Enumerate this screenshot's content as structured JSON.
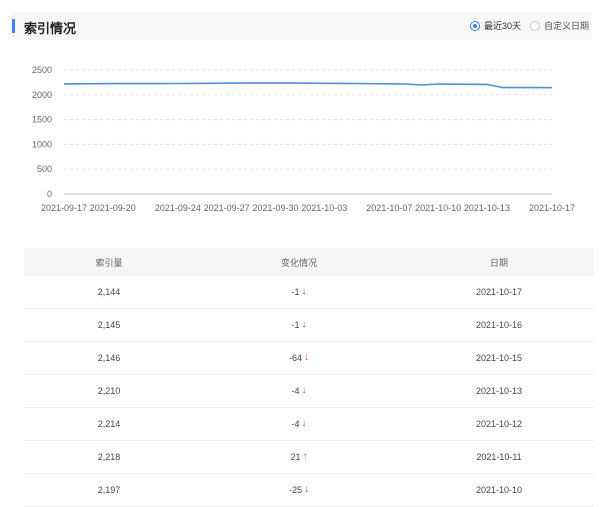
{
  "section": {
    "title": "索引情况",
    "range_options": [
      {
        "label": "最近30天",
        "selected": true
      },
      {
        "label": "自定义日期",
        "selected": false
      }
    ]
  },
  "chart_data": {
    "type": "line",
    "x": [
      "2021-09-17",
      "2021-09-18",
      "2021-09-19",
      "2021-09-20",
      "2021-09-21",
      "2021-09-22",
      "2021-09-23",
      "2021-09-24",
      "2021-09-25",
      "2021-09-26",
      "2021-09-27",
      "2021-09-28",
      "2021-09-29",
      "2021-09-30",
      "2021-10-01",
      "2021-10-02",
      "2021-10-03",
      "2021-10-04",
      "2021-10-05",
      "2021-10-06",
      "2021-10-07",
      "2021-10-08",
      "2021-10-09",
      "2021-10-10",
      "2021-10-11",
      "2021-10-12",
      "2021-10-13",
      "2021-10-14",
      "2021-10-15",
      "2021-10-16",
      "2021-10-17"
    ],
    "series": [
      {
        "values": [
          2220,
          2222,
          2224,
          2225,
          2225,
          2226,
          2226,
          2228,
          2230,
          2232,
          2234,
          2236,
          2236,
          2236,
          2236,
          2234,
          2232,
          2230,
          2228,
          2224,
          2222,
          2218,
          2197,
          2218,
          2214,
          2212,
          2210,
          2146,
          2145,
          2146,
          2144
        ],
        "color": "#4a90e2"
      }
    ],
    "x_tick_labels": [
      "2021-09-17",
      "2021-09-20",
      "2021-09-24",
      "2021-09-27",
      "2021-09-30",
      "2021-10-03",
      "2021-10-07",
      "2021-10-10",
      "2021-10-13",
      "2021-10-17"
    ],
    "y_ticks": [
      0,
      500,
      1000,
      1500,
      2000,
      2500
    ],
    "ylim": [
      0,
      2500
    ],
    "grid": true
  },
  "table": {
    "headers": [
      "索引量",
      "变化情况",
      "日期"
    ],
    "rows": [
      {
        "count": "2,144",
        "change": "-1",
        "dir": "down",
        "date": "2021-10-17"
      },
      {
        "count": "2,145",
        "change": "-1",
        "dir": "down",
        "date": "2021-10-16"
      },
      {
        "count": "2,146",
        "change": "-64",
        "dir": "down",
        "date": "2021-10-15"
      },
      {
        "count": "2,210",
        "change": "-4",
        "dir": "down",
        "date": "2021-10-13"
      },
      {
        "count": "2,214",
        "change": "-4",
        "dir": "down",
        "date": "2021-10-12"
      },
      {
        "count": "2,218",
        "change": "21",
        "dir": "up",
        "date": "2021-10-11"
      },
      {
        "count": "2,197",
        "change": "-25",
        "dir": "down",
        "date": "2021-10-10"
      }
    ]
  },
  "icons": {
    "down": "↓",
    "up": "↑"
  }
}
